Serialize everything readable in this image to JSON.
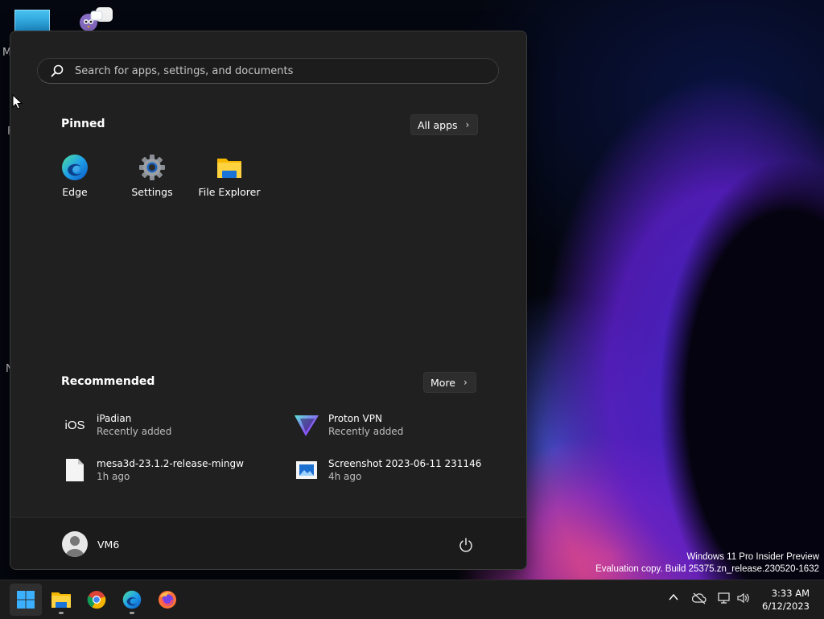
{
  "desktop": {
    "edge_letters": [
      "M",
      "F",
      "N"
    ]
  },
  "watermark": {
    "line1": "Windows 11 Pro Insider Preview",
    "line2": "Evaluation copy. Build 25375.zn_release.230520-1632"
  },
  "start_menu": {
    "search_placeholder": "Search for apps, settings, and documents",
    "pinned_title": "Pinned",
    "all_apps_label": "All apps",
    "pinned": [
      {
        "label": "Edge",
        "icon": "edge-icon"
      },
      {
        "label": "Settings",
        "icon": "settings-gear-icon"
      },
      {
        "label": "File Explorer",
        "icon": "folder-icon"
      }
    ],
    "recommended_title": "Recommended",
    "more_label": "More",
    "recommended": [
      {
        "name": "iPadian",
        "sub": "Recently added",
        "icon": "ios-icon"
      },
      {
        "name": "Proton VPN",
        "sub": "Recently added",
        "icon": "protonvpn-icon"
      },
      {
        "name": "mesa3d-23.1.2-release-mingw",
        "sub": "1h ago",
        "icon": "file-icon"
      },
      {
        "name": "Screenshot 2023-06-11 231146",
        "sub": "4h ago",
        "icon": "image-file-icon"
      }
    ],
    "user_name": "VM6",
    "ios_text": "iOS"
  },
  "taskbar": {
    "time": "3:33 AM",
    "date": "6/12/2023"
  },
  "colors": {
    "menu_bg": "#202020",
    "accent": "#0078d4",
    "taskbar_bg": "#1c1c1c"
  }
}
